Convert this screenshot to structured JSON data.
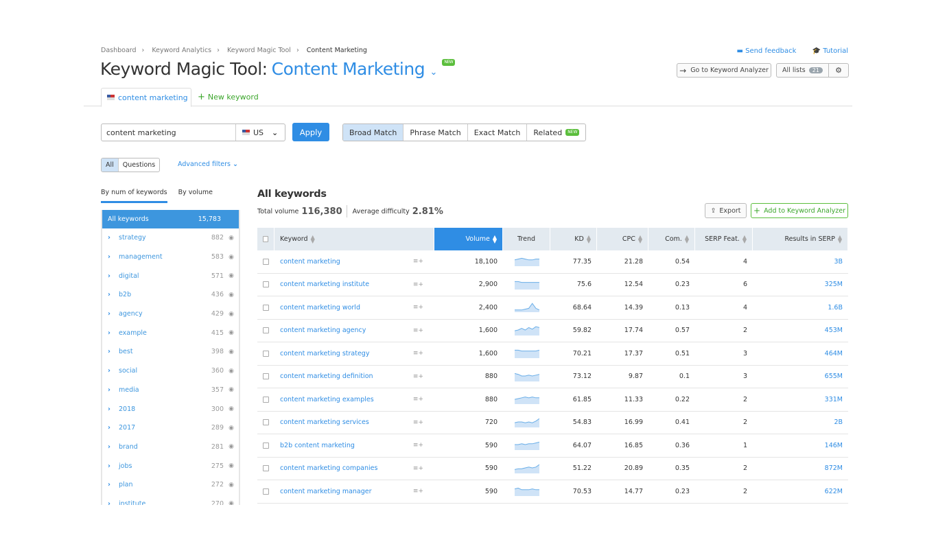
{
  "breadcrumb": [
    "Dashboard",
    "Keyword Analytics",
    "Keyword Magic Tool",
    "Content Marketing"
  ],
  "header": {
    "title": "Keyword Magic Tool:",
    "keyword": "Content Marketing",
    "new_badge": "NEW",
    "send_feedback": "Send feedback",
    "tutorial": "Tutorial",
    "go_to_analyzer": "Go to Keyword Analyzer",
    "all_lists": "All lists",
    "all_lists_count": "21"
  },
  "tabs": {
    "active": "content marketing",
    "new_keyword": "New keyword"
  },
  "search": {
    "value": "content marketing",
    "country": "US",
    "apply": "Apply"
  },
  "match": {
    "items": [
      "Broad Match",
      "Phrase Match",
      "Exact Match",
      "Related"
    ],
    "active": 0,
    "related_badge": "NEW"
  },
  "filters": {
    "all": "All",
    "questions": "Questions",
    "advanced": "Advanced filters"
  },
  "sidebar": {
    "tabs": [
      "By num of keywords",
      "By volume"
    ],
    "all_label": "All keywords",
    "all_count": "15,783",
    "items": [
      {
        "label": "strategy",
        "count": "882"
      },
      {
        "label": "management",
        "count": "583"
      },
      {
        "label": "digital",
        "count": "571"
      },
      {
        "label": "b2b",
        "count": "436"
      },
      {
        "label": "agency",
        "count": "429"
      },
      {
        "label": "example",
        "count": "415"
      },
      {
        "label": "best",
        "count": "398"
      },
      {
        "label": "social",
        "count": "360"
      },
      {
        "label": "media",
        "count": "357"
      },
      {
        "label": "2018",
        "count": "300"
      },
      {
        "label": "2017",
        "count": "289"
      },
      {
        "label": "brand",
        "count": "281"
      },
      {
        "label": "jobs",
        "count": "275"
      },
      {
        "label": "plan",
        "count": "272"
      },
      {
        "label": "institute",
        "count": "270"
      }
    ]
  },
  "main": {
    "title": "All keywords",
    "total_volume_label": "Total volume",
    "total_volume": "116,380",
    "avg_difficulty_label": "Average difficulty",
    "avg_difficulty": "2.81%",
    "export": "Export",
    "add_to_analyzer": "Add to Keyword Analyzer",
    "columns": [
      "Keyword",
      "Volume",
      "Trend",
      "KD",
      "CPC",
      "Com.",
      "SERP Feat.",
      "Results in SERP"
    ],
    "rows": [
      {
        "keyword": "content marketing",
        "volume": "18,100",
        "trend": [
          6,
          7,
          8,
          7,
          6,
          6,
          7,
          7
        ],
        "kd": "77.35",
        "cpc": "21.28",
        "com": "0.54",
        "serp": "4",
        "results": "3B"
      },
      {
        "keyword": "content marketing institute",
        "volume": "2,900",
        "trend": [
          8,
          8,
          7,
          7,
          7,
          7,
          7,
          7
        ],
        "kd": "75.6",
        "cpc": "12.54",
        "com": "0.23",
        "serp": "6",
        "results": "325M"
      },
      {
        "keyword": "content marketing world",
        "volume": "2,400",
        "trend": [
          1,
          1,
          1,
          2,
          3,
          9,
          3,
          1
        ],
        "kd": "68.64",
        "cpc": "14.39",
        "com": "0.13",
        "serp": "4",
        "results": "1.6B"
      },
      {
        "keyword": "content marketing agency",
        "volume": "1,600",
        "trend": [
          4,
          5,
          7,
          5,
          8,
          6,
          9,
          8
        ],
        "kd": "59.82",
        "cpc": "17.74",
        "com": "0.57",
        "serp": "2",
        "results": "453M"
      },
      {
        "keyword": "content marketing strategy",
        "volume": "1,600",
        "trend": [
          8,
          8,
          7,
          7,
          7,
          7,
          7,
          8
        ],
        "kd": "70.21",
        "cpc": "17.37",
        "com": "0.51",
        "serp": "3",
        "results": "464M"
      },
      {
        "keyword": "content marketing definition",
        "volume": "880",
        "trend": [
          8,
          7,
          5,
          5,
          6,
          5,
          6,
          7
        ],
        "kd": "73.12",
        "cpc": "9.87",
        "com": "0.1",
        "serp": "3",
        "results": "655M"
      },
      {
        "keyword": "content marketing examples",
        "volume": "880",
        "trend": [
          4,
          5,
          6,
          7,
          6,
          7,
          6,
          6
        ],
        "kd": "61.85",
        "cpc": "11.33",
        "com": "0.22",
        "serp": "2",
        "results": "331M"
      },
      {
        "keyword": "content marketing services",
        "volume": "720",
        "trend": [
          4,
          5,
          5,
          4,
          5,
          4,
          6,
          9
        ],
        "kd": "54.83",
        "cpc": "16.99",
        "com": "0.41",
        "serp": "2",
        "results": "2B"
      },
      {
        "keyword": "b2b content marketing",
        "volume": "590",
        "trend": [
          5,
          5,
          6,
          5,
          6,
          6,
          7,
          8
        ],
        "kd": "64.07",
        "cpc": "16.85",
        "com": "0.36",
        "serp": "1",
        "results": "146M"
      },
      {
        "keyword": "content marketing companies",
        "volume": "590",
        "trend": [
          3,
          4,
          4,
          5,
          6,
          5,
          6,
          9
        ],
        "kd": "51.22",
        "cpc": "20.89",
        "com": "0.35",
        "serp": "2",
        "results": "872M"
      },
      {
        "keyword": "content marketing manager",
        "volume": "590",
        "trend": [
          7,
          8,
          6,
          6,
          6,
          7,
          6,
          6
        ],
        "kd": "70.53",
        "cpc": "14.77",
        "com": "0.23",
        "serp": "2",
        "results": "622M"
      }
    ]
  },
  "colors": {
    "accent": "#2f8de4",
    "green": "#5bbe3c",
    "header_bg": "#e3eaf0"
  }
}
